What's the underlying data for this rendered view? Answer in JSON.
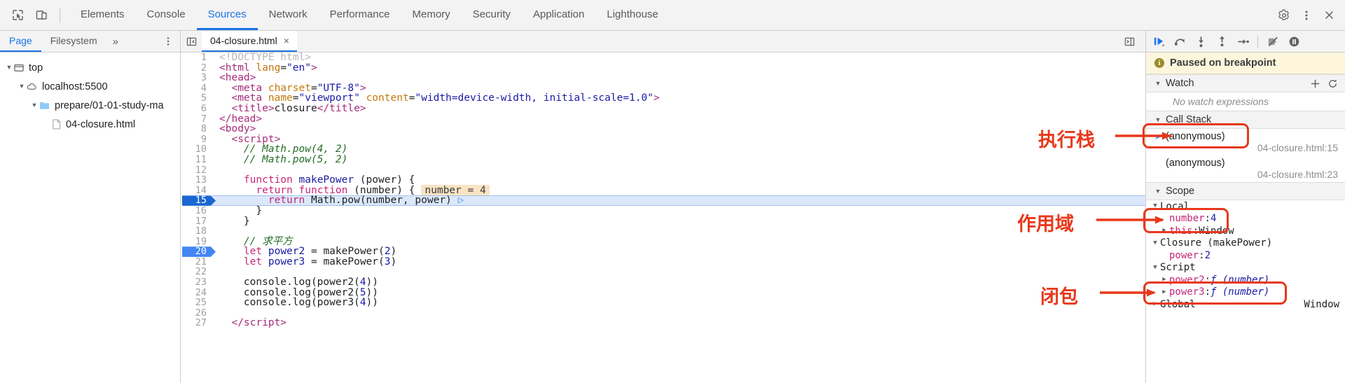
{
  "toolbar": {
    "icons": [
      {
        "name": "inspect-element-icon",
        "glyph": "cursor"
      },
      {
        "name": "device-toolbar-icon",
        "glyph": "device"
      }
    ],
    "tabs": [
      {
        "label": "Elements",
        "active": false
      },
      {
        "label": "Console",
        "active": false
      },
      {
        "label": "Sources",
        "active": true
      },
      {
        "label": "Network",
        "active": false
      },
      {
        "label": "Performance",
        "active": false
      },
      {
        "label": "Memory",
        "active": false
      },
      {
        "label": "Security",
        "active": false
      },
      {
        "label": "Application",
        "active": false
      },
      {
        "label": "Lighthouse",
        "active": false
      }
    ],
    "right_icons": [
      {
        "name": "settings-gear-icon"
      },
      {
        "name": "more-options-kebab-icon"
      },
      {
        "name": "close-devtools-icon"
      }
    ],
    "active_tab_color": "#1a73e8"
  },
  "navigator": {
    "tabs": [
      {
        "label": "Page",
        "active": true
      },
      {
        "label": "Filesystem",
        "active": false
      }
    ],
    "more_label": "»",
    "kebab_name": "navigator-more-options",
    "tree": [
      {
        "label": "top",
        "icon": "frame-icon",
        "indent": 0,
        "expanded": true
      },
      {
        "label": "localhost:5500",
        "icon": "cloud-icon",
        "indent": 1,
        "expanded": true
      },
      {
        "label": "prepare/01-01-study-ma",
        "icon": "folder-icon",
        "indent": 2,
        "expanded": true
      },
      {
        "label": "04-closure.html",
        "icon": "file-icon",
        "indent": 3,
        "expanded": null
      }
    ]
  },
  "editor": {
    "tab_label": "04-closure.html",
    "tab_close": "×",
    "current_line": 15,
    "breakpoint_lines": [
      15,
      20
    ],
    "inline_value": "number = 4",
    "lines": [
      {
        "n": 1,
        "tokens": [
          {
            "t": "dim",
            "v": "<!DOCTYPE html>"
          }
        ]
      },
      {
        "n": 2,
        "tokens": [
          {
            "t": "tag",
            "v": "<html "
          },
          {
            "t": "attr",
            "v": "lang"
          },
          {
            "t": "pln",
            "v": "="
          },
          {
            "t": "str",
            "v": "\"en\""
          },
          {
            "t": "tag",
            "v": ">"
          }
        ]
      },
      {
        "n": 3,
        "tokens": [
          {
            "t": "tag",
            "v": "<head>"
          }
        ]
      },
      {
        "n": 4,
        "tokens": [
          {
            "t": "pln",
            "v": "  "
          },
          {
            "t": "tag",
            "v": "<meta "
          },
          {
            "t": "attr",
            "v": "charset"
          },
          {
            "t": "pln",
            "v": "="
          },
          {
            "t": "str",
            "v": "\"UTF-8\""
          },
          {
            "t": "tag",
            "v": ">"
          }
        ]
      },
      {
        "n": 5,
        "tokens": [
          {
            "t": "pln",
            "v": "  "
          },
          {
            "t": "tag",
            "v": "<meta "
          },
          {
            "t": "attr",
            "v": "name"
          },
          {
            "t": "pln",
            "v": "="
          },
          {
            "t": "str",
            "v": "\"viewport\""
          },
          {
            "t": "pln",
            "v": " "
          },
          {
            "t": "attr",
            "v": "content"
          },
          {
            "t": "pln",
            "v": "="
          },
          {
            "t": "str",
            "v": "\"width=device-width, initial-scale=1.0\""
          },
          {
            "t": "tag",
            "v": ">"
          }
        ]
      },
      {
        "n": 6,
        "tokens": [
          {
            "t": "pln",
            "v": "  "
          },
          {
            "t": "tag",
            "v": "<title>"
          },
          {
            "t": "pln",
            "v": "closure"
          },
          {
            "t": "tag",
            "v": "</title>"
          }
        ]
      },
      {
        "n": 7,
        "tokens": [
          {
            "t": "tag",
            "v": "</head>"
          }
        ]
      },
      {
        "n": 8,
        "tokens": [
          {
            "t": "tag",
            "v": "<body>"
          }
        ]
      },
      {
        "n": 9,
        "tokens": [
          {
            "t": "pln",
            "v": "  "
          },
          {
            "t": "tag",
            "v": "<script>"
          }
        ]
      },
      {
        "n": 10,
        "tokens": [
          {
            "t": "pln",
            "v": "    "
          },
          {
            "t": "com",
            "v": "// Math.pow(4, 2)"
          }
        ]
      },
      {
        "n": 11,
        "tokens": [
          {
            "t": "pln",
            "v": "    "
          },
          {
            "t": "com",
            "v": "// Math.pow(5, 2)"
          }
        ]
      },
      {
        "n": 12,
        "tokens": []
      },
      {
        "n": 13,
        "tokens": [
          {
            "t": "pln",
            "v": "    "
          },
          {
            "t": "kw",
            "v": "function"
          },
          {
            "t": "pln",
            "v": " "
          },
          {
            "t": "def",
            "v": "makePower"
          },
          {
            "t": "pln",
            "v": " (power) {"
          }
        ]
      },
      {
        "n": 14,
        "tokens": [
          {
            "t": "pln",
            "v": "      "
          },
          {
            "t": "kw",
            "v": "return"
          },
          {
            "t": "pln",
            "v": " "
          },
          {
            "t": "kw",
            "v": "function"
          },
          {
            "t": "pln",
            "v": " (number) {"
          }
        ],
        "inline": "number = 4"
      },
      {
        "n": 15,
        "tokens": [
          {
            "t": "pln",
            "v": "        "
          },
          {
            "t": "kw",
            "v": "return"
          },
          {
            "t": "pln",
            "v": " Math."
          },
          {
            "t": "fn",
            "v": "pow"
          },
          {
            "t": "pln",
            "v": "(number, power)"
          }
        ]
      },
      {
        "n": 16,
        "tokens": [
          {
            "t": "pln",
            "v": "      }"
          }
        ]
      },
      {
        "n": 17,
        "tokens": [
          {
            "t": "pln",
            "v": "    }"
          }
        ]
      },
      {
        "n": 18,
        "tokens": []
      },
      {
        "n": 19,
        "tokens": [
          {
            "t": "pln",
            "v": "    "
          },
          {
            "t": "com",
            "v": "// 求平方"
          }
        ]
      },
      {
        "n": 20,
        "tokens": [
          {
            "t": "pln",
            "v": "    "
          },
          {
            "t": "kw",
            "v": "let"
          },
          {
            "t": "pln",
            "v": " "
          },
          {
            "t": "def",
            "v": "power2"
          },
          {
            "t": "pln",
            "v": " = makePower("
          },
          {
            "t": "num",
            "v": "2"
          },
          {
            "t": "pln",
            "v": ")"
          }
        ]
      },
      {
        "n": 21,
        "tokens": [
          {
            "t": "pln",
            "v": "    "
          },
          {
            "t": "kw",
            "v": "let"
          },
          {
            "t": "pln",
            "v": " "
          },
          {
            "t": "def",
            "v": "power3"
          },
          {
            "t": "pln",
            "v": " = makePower("
          },
          {
            "t": "num",
            "v": "3"
          },
          {
            "t": "pln",
            "v": ")"
          }
        ]
      },
      {
        "n": 22,
        "tokens": []
      },
      {
        "n": 23,
        "tokens": [
          {
            "t": "pln",
            "v": "    console.log(power2("
          },
          {
            "t": "num",
            "v": "4"
          },
          {
            "t": "pln",
            "v": "))"
          }
        ]
      },
      {
        "n": 24,
        "tokens": [
          {
            "t": "pln",
            "v": "    console.log(power2("
          },
          {
            "t": "num",
            "v": "5"
          },
          {
            "t": "pln",
            "v": "))"
          }
        ]
      },
      {
        "n": 25,
        "tokens": [
          {
            "t": "pln",
            "v": "    console.log(power3("
          },
          {
            "t": "num",
            "v": "4"
          },
          {
            "t": "pln",
            "v": "))"
          }
        ]
      },
      {
        "n": 26,
        "tokens": []
      },
      {
        "n": 27,
        "tokens": [
          {
            "t": "pln",
            "v": "  "
          },
          {
            "t": "tag",
            "v": "</script>"
          }
        ]
      }
    ]
  },
  "debugger": {
    "toolbar_icons": [
      {
        "name": "resume-script-execution-icon"
      },
      {
        "name": "step-over-next-function-call-icon"
      },
      {
        "name": "step-into-next-function-call-icon"
      },
      {
        "name": "step-out-of-current-function-icon"
      },
      {
        "name": "step-icon"
      },
      {
        "name": "deactivate-breakpoints-icon"
      },
      {
        "name": "pause-on-exceptions-icon"
      }
    ],
    "paused_message": "Paused on breakpoint",
    "watch": {
      "title": "Watch",
      "empty_text": "No watch expressions",
      "add_label": "+",
      "refresh_label": "↻"
    },
    "call_stack": {
      "title": "Call Stack",
      "frames": [
        {
          "name": "(anonymous)",
          "location": "04-closure.html:15",
          "selected": true
        },
        {
          "name": "(anonymous)",
          "location": "04-closure.html:23",
          "selected": false
        }
      ]
    },
    "scope": {
      "title": "Scope",
      "entries": [
        {
          "indent": 0,
          "arrow": "down",
          "label": "Local",
          "kind": "group"
        },
        {
          "indent": 1,
          "arrow": "none",
          "label": "number",
          "value": "4",
          "kind": "num"
        },
        {
          "indent": 1,
          "arrow": "right",
          "label": "this",
          "value": "Window",
          "kind": "obj"
        },
        {
          "indent": 0,
          "arrow": "down",
          "label": "Closure (makePower)",
          "kind": "group"
        },
        {
          "indent": 1,
          "arrow": "none",
          "label": "power",
          "value": "2",
          "kind": "num"
        },
        {
          "indent": 0,
          "arrow": "down",
          "label": "Script",
          "kind": "group"
        },
        {
          "indent": 1,
          "arrow": "right",
          "label": "power2",
          "value": "ƒ (number)",
          "kind": "fn"
        },
        {
          "indent": 1,
          "arrow": "right",
          "label": "power3",
          "value": "ƒ (number)",
          "kind": "fn"
        },
        {
          "indent": 0,
          "arrow": "right",
          "label": "Global",
          "value": "Window",
          "kind": "right"
        }
      ]
    }
  },
  "annotations": {
    "color": "#e8381b",
    "items": [
      {
        "text": "执行栈",
        "target": "call-stack-section"
      },
      {
        "text": "作用域",
        "target": "scope-section"
      },
      {
        "text": "闭包",
        "target": "closure-scope-entry"
      }
    ]
  }
}
